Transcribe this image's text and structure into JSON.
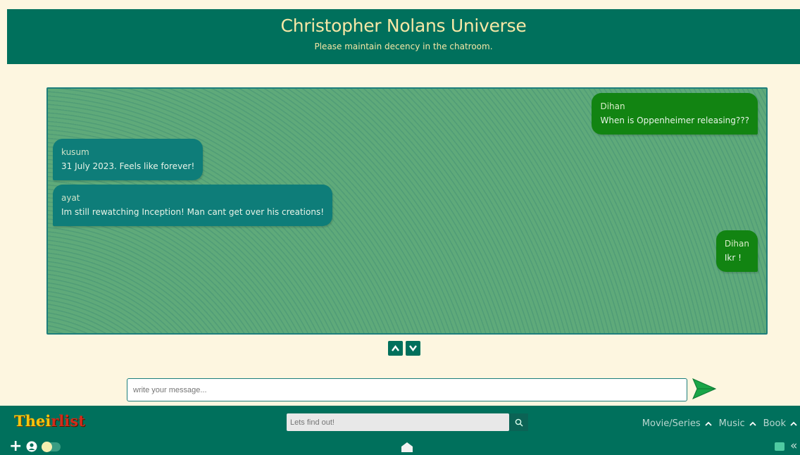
{
  "header": {
    "title": "Christopher Nolans Universe",
    "subtitle": "Please maintain decency in the chatroom."
  },
  "messages": [
    {
      "sender": "Dihan",
      "text": "When is Oppenheimer releasing???",
      "side": "right"
    },
    {
      "sender": "kusum",
      "text": "31 July 2023. Feels like forever!",
      "side": "left"
    },
    {
      "sender": "ayat",
      "text": "Im still rewatching Inception! Man cant get over his creations!",
      "side": "left"
    },
    {
      "sender": "Dihan",
      "text": "Ikr !",
      "side": "right"
    }
  ],
  "scroll": {
    "up_label": "∧",
    "down_label": "∨"
  },
  "composer": {
    "placeholder": "write your message..."
  },
  "footer": {
    "logo_part1": "Thei",
    "logo_part2": "rlist",
    "search_placeholder": "Lets find out!",
    "nav": [
      {
        "label": "Movie/Series"
      },
      {
        "label": "Music"
      },
      {
        "label": "Book"
      }
    ],
    "plus_label": "+"
  },
  "colors": {
    "header_bg": "#00705c",
    "title_color": "#f6e7a6",
    "page_bg": "#fdf6e0",
    "left_bubble": "#0e7d79",
    "right_bubble": "#128412",
    "send_arrow": "#1aa548"
  }
}
